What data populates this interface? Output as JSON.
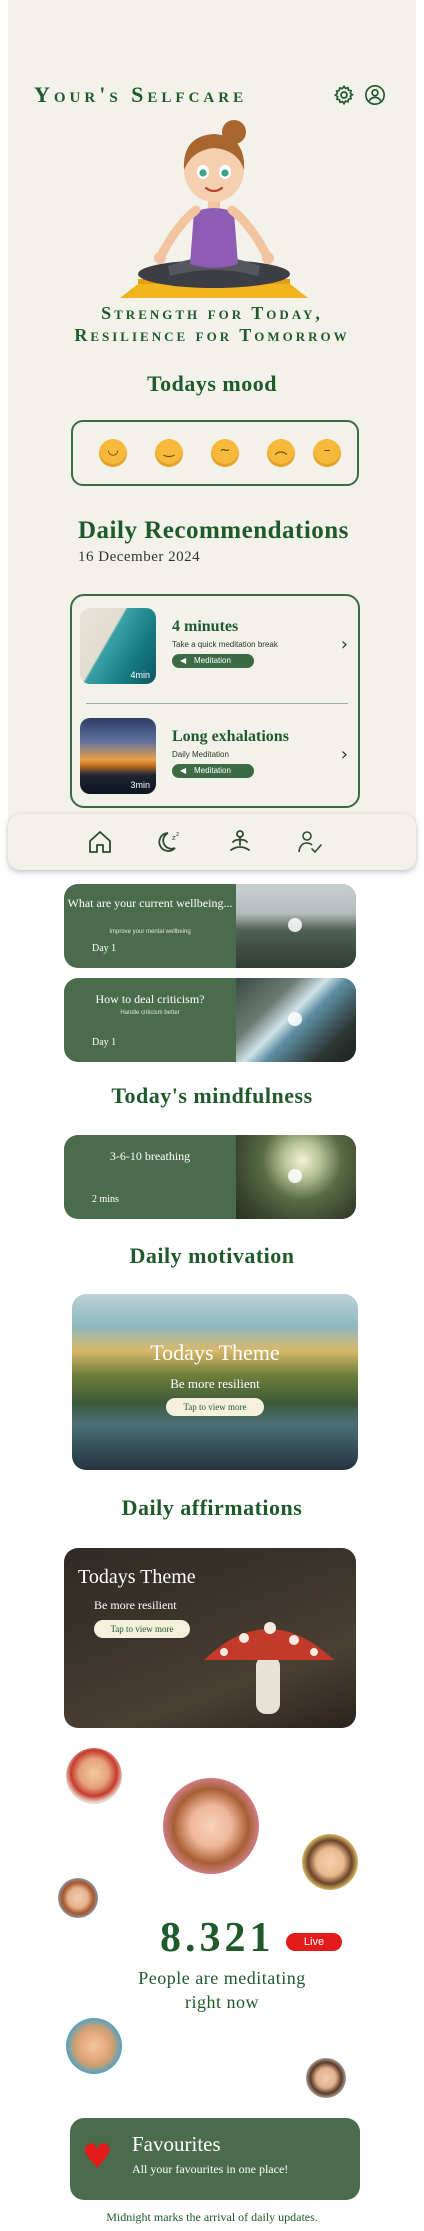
{
  "header": {
    "title": "Your's Selfcare"
  },
  "tagline": {
    "line1": "Strength for Today,",
    "line2": "Resilience for Tomorrow"
  },
  "mood": {
    "title": "Todays mood",
    "emojis": [
      "grinning-face",
      "smiling-face",
      "worried-face",
      "sad-face",
      "pensive-face"
    ]
  },
  "recommendations": {
    "title": "Daily Recommendations",
    "date": "16 December 2024",
    "items": [
      {
        "duration": "4min",
        "name": "4 minutes",
        "subtitle": "Take a quick meditation break",
        "tag": "Meditation"
      },
      {
        "duration": "3min",
        "name": "Long exhalations",
        "subtitle": "Daily Meditation",
        "tag": "Meditation"
      }
    ]
  },
  "nav": {
    "items": [
      "home-icon",
      "sleep-moon-icon",
      "meditation-icon",
      "profile-check-icon"
    ]
  },
  "programs": [
    {
      "title": "What are your current wellbeing...",
      "subtitle": "Improve your mental wellbeing",
      "day": "Day 1"
    },
    {
      "title": "How to deal criticism?",
      "subtitle": "Handle criticism better",
      "day": "Day 1"
    }
  ],
  "mindfulness": {
    "title": "Today's mindfulness",
    "item": {
      "title": "3-6-10 breathing",
      "duration": "2 mins"
    }
  },
  "motivation": {
    "title": "Daily motivation",
    "card": {
      "title": "Todays Theme",
      "subtitle": "Be more resilient",
      "button": "Tap to view more"
    }
  },
  "affirmations": {
    "title": "Daily affirmations",
    "card": {
      "title": "Todays Theme",
      "subtitle": "Be more resilient",
      "button": "Tap to view more"
    }
  },
  "community": {
    "count": "8.321",
    "live": "Live",
    "text_line1": "People are meditating",
    "text_line2": "right now"
  },
  "favourites": {
    "title": "Favourites",
    "subtitle": "All your favourites in one place!"
  },
  "footer": {
    "text": "Midnight marks the arrival of daily updates."
  },
  "colors": {
    "primary": "#1f5a2c",
    "card_green": "#4a6b4c",
    "background": "#f3f2ea",
    "live_red": "#e41b1b"
  }
}
